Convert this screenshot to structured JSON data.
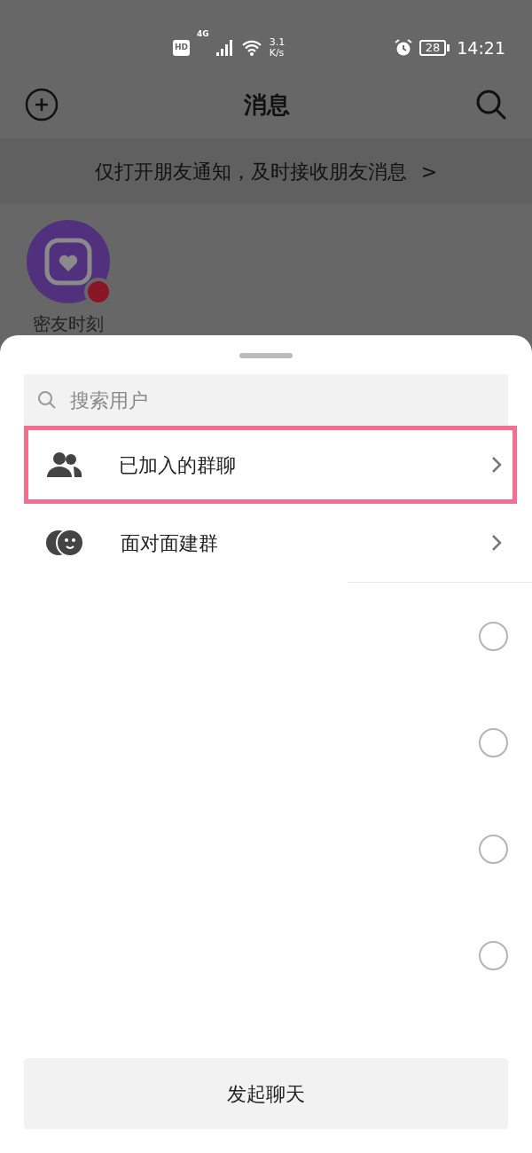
{
  "status_bar": {
    "hd": "HD",
    "network": "4G",
    "speed_value": "3.1",
    "speed_unit": "K/s",
    "battery": "28",
    "time": "14:21"
  },
  "header": {
    "title": "消息"
  },
  "notice": {
    "text": "仅打开朋友通知，及时接收朋友消息",
    "arrow": ">"
  },
  "stories": [
    {
      "label": "密友时刻",
      "unread": true
    }
  ],
  "sheet": {
    "search": {
      "placeholder": "搜索用户"
    },
    "options": [
      {
        "kind": "groups",
        "label": "已加入的群聊",
        "highlighted": true
      },
      {
        "kind": "face",
        "label": "面对面建群",
        "highlighted": false
      }
    ],
    "contacts": [
      {
        "selected": false
      },
      {
        "selected": false
      },
      {
        "selected": false
      },
      {
        "selected": false
      }
    ],
    "start_button": "发起聊天"
  }
}
